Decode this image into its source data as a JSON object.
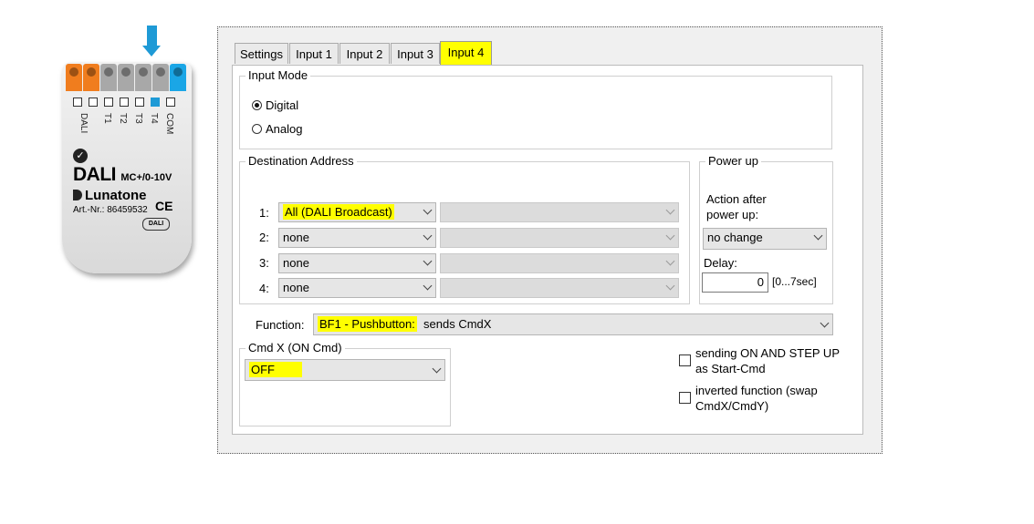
{
  "device": {
    "terminal_labels": [
      "DALI",
      "T1",
      "T2",
      "T3",
      "T4",
      "COM"
    ],
    "product_name": "DALI",
    "product_variant": "MC+/0-10V",
    "brand": "Lunatone",
    "ce_mark": "CE",
    "article_number": "Art.-Nr.: 86459532",
    "dali_logo": "DALI",
    "colors": {
      "orange_terminal": "#f07d1e",
      "grey_terminal": "#a8a8a8",
      "blue_terminal": "#1aa6e6",
      "arrow": "#1e9ad6"
    }
  },
  "tabs": [
    {
      "label": "Settings",
      "active": false
    },
    {
      "label": "Input 1",
      "active": false
    },
    {
      "label": "Input 2",
      "active": false
    },
    {
      "label": "Input 3",
      "active": false
    },
    {
      "label": "Input 4",
      "active": true
    }
  ],
  "input_mode": {
    "title": "Input Mode",
    "options": [
      {
        "label": "Digital",
        "selected": true
      },
      {
        "label": "Analog",
        "selected": false
      }
    ]
  },
  "destination": {
    "title": "Destination Address",
    "rows": [
      {
        "index": "1:",
        "value": "All (DALI Broadcast)",
        "highlighted": true,
        "secondary": ""
      },
      {
        "index": "2:",
        "value": "none",
        "highlighted": false,
        "secondary": ""
      },
      {
        "index": "3:",
        "value": "none",
        "highlighted": false,
        "secondary": ""
      },
      {
        "index": "4:",
        "value": "none",
        "highlighted": false,
        "secondary": ""
      }
    ]
  },
  "power_up": {
    "title": "Power up",
    "action_label_line1": "Action after",
    "action_label_line2": "power up:",
    "action_value": "no change",
    "delay_label": "Delay:",
    "delay_value": "0",
    "delay_range": "[0...7sec]"
  },
  "function": {
    "label": "Function:",
    "value_highlighted": "BF1 - Pushbutton:",
    "value_rest": "sends CmdX"
  },
  "cmdx": {
    "title": "Cmd X  (ON Cmd)",
    "value": "OFF"
  },
  "options": {
    "start_cmd_line1": "sending ON AND STEP UP",
    "start_cmd_line2": "as Start-Cmd",
    "start_cmd_checked": false,
    "inverted_line1": "inverted function (swap",
    "inverted_line2": "CmdX/CmdY)",
    "inverted_checked": false
  },
  "highlight_color": "#ffff00"
}
